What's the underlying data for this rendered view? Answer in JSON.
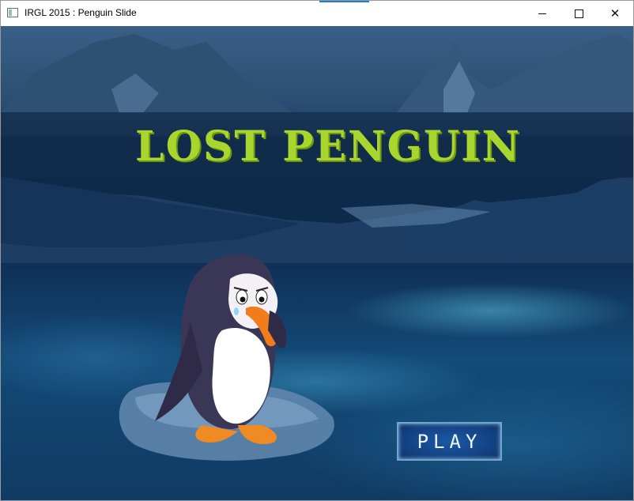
{
  "window": {
    "title": "IRGL 2015 : Penguin Slide",
    "controls": {
      "minimize": "minimize-icon",
      "maximize": "maximize-icon",
      "close": "close-icon"
    }
  },
  "game": {
    "title": "LOST PENGUIN",
    "play_label": "PLAY"
  },
  "colors": {
    "title_green": "#a8d62e",
    "banner": "#142d4b",
    "play_button": "#1a59a8"
  }
}
